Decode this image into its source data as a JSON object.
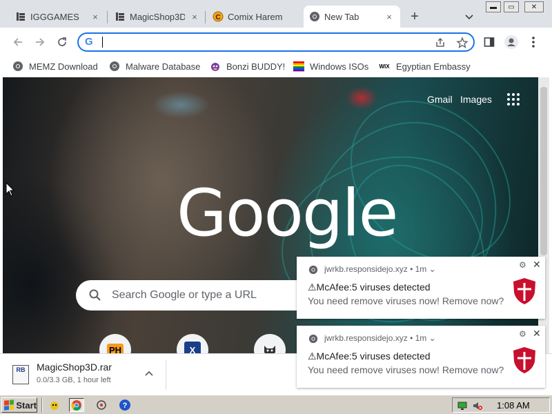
{
  "tabs": [
    {
      "title": "IGGGAMES",
      "close": "×",
      "favicon": "stack-icon"
    },
    {
      "title": "MagicShop3D",
      "close": "×",
      "favicon": "stack-icon"
    },
    {
      "title": "Comix Harem",
      "close": "×",
      "favicon": "coin-c-icon"
    },
    {
      "title": "New Tab",
      "close": "×",
      "favicon": "chrome-icon",
      "active": true
    }
  ],
  "new_tab": "+",
  "window_controls": {
    "minimize": "▬",
    "maximize": "▭",
    "close": "✕"
  },
  "omnibox": {
    "value": "",
    "placeholder": "",
    "engine_badge": "G"
  },
  "bookmarks": [
    {
      "label": "MEMZ Download",
      "icon": "chrome-icon"
    },
    {
      "label": "Malware Database",
      "icon": "chrome-icon"
    },
    {
      "label": "Bonzi BUDDY!",
      "icon": "bonzi-icon"
    },
    {
      "label": "Windows ISOs",
      "icon": "rainbow-flag-icon"
    },
    {
      "label": "Egyptian Embassy",
      "icon": "wix-icon",
      "icon_text": "WIX"
    }
  ],
  "ntp": {
    "gmail": "Gmail",
    "images": "Images",
    "logo": "Google",
    "search_placeholder": "Search Google or type a URL",
    "shortcuts": [
      {
        "icon": "ph-icon",
        "text": "PH",
        "bg": "#f79a1e"
      },
      {
        "icon": "x-shield-icon",
        "text": "X",
        "bg": "#1a3f8a"
      },
      {
        "icon": "cat-icon",
        "text": "",
        "bg": "#ffffff"
      }
    ]
  },
  "download": {
    "filename": "MagicShop3D.rar",
    "status": "0.0/3.3 GB, 1 hour left",
    "icon_text": "RB"
  },
  "notifications": [
    {
      "source": "jwrkb.responsidejo.xyz",
      "time": "1m",
      "title": "⚠McAfee:5 viruses detected",
      "body": "You need remove viruses now! Remove now?"
    },
    {
      "source": "jwrkb.responsidejo.xyz",
      "time": "1m",
      "title": "⚠McAfee:5 viruses detected",
      "body": "You need remove viruses now! Remove now?"
    }
  ],
  "taskbar": {
    "start": "Start",
    "clock": "1:08 AM"
  },
  "colors": {
    "accent": "#1a73e8",
    "mcafee_red": "#c8102e",
    "taskbar": "#d4d0c8",
    "tabstrip": "#dee1e6"
  }
}
